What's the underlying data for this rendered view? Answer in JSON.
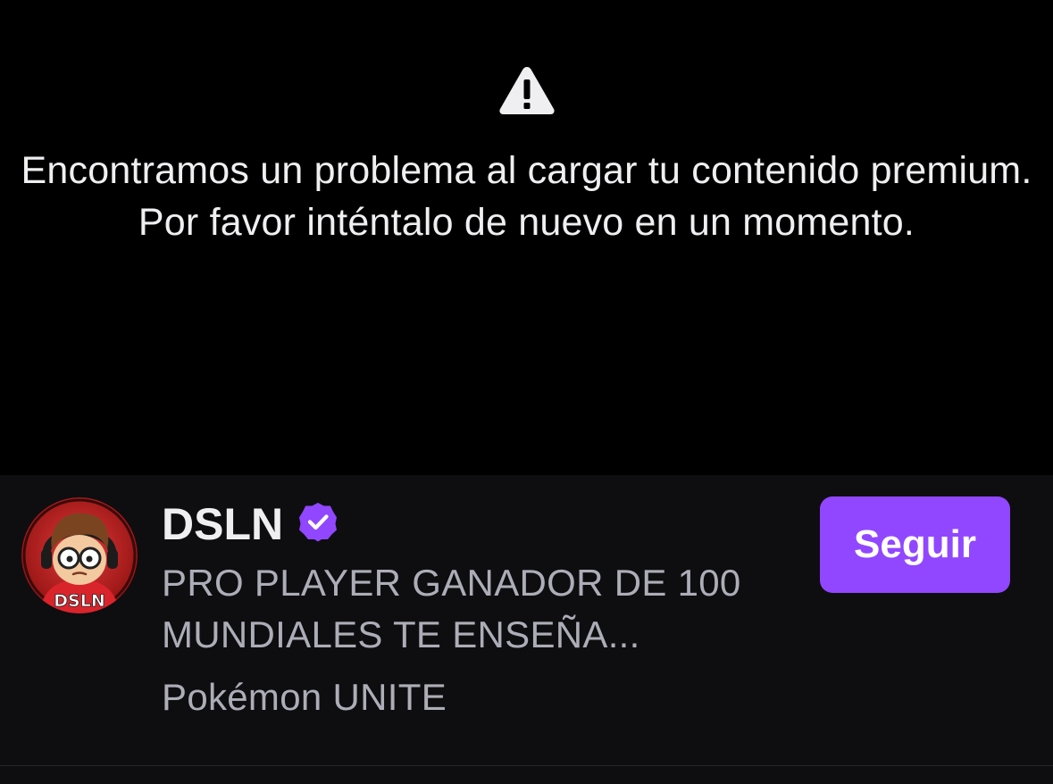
{
  "player": {
    "warning_icon": "warning-triangle-icon",
    "error_message": "Encontramos un problema al cargar tu contenido premium. Por favor inténtalo de nuevo en un momento."
  },
  "channel": {
    "name": "DSLN",
    "avatar_text": "DSLN",
    "verified_icon": "verified-badge-icon",
    "stream_title": "PRO PLAYER GANADOR DE 100 MUNDIALES TE ENSEÑA...",
    "game": "Pokémon UNITE",
    "follow_label": "Seguir"
  },
  "colors": {
    "background": "#000000",
    "info_bar": "#0e0e10",
    "accent": "#9147ff",
    "primary_text": "#efeff1",
    "secondary_text": "#adadb8"
  }
}
